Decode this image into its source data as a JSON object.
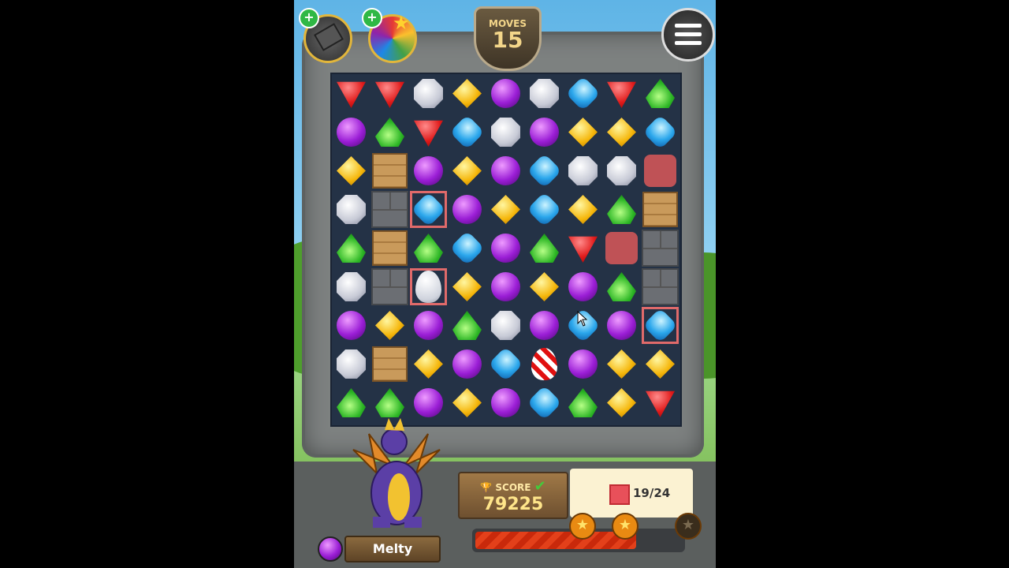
{
  "hud": {
    "moves_label": "MOVES",
    "moves_value": "15",
    "score_label": "SCORE",
    "score_value": "79225",
    "goal_text": "19/24",
    "progress_fraction": 0.78,
    "stars_earned": 2,
    "stars_total": 3,
    "character_name": "Melty"
  },
  "board": {
    "rows": [
      [
        "red",
        "red",
        "white",
        "yellow",
        "purple",
        "white",
        "blue",
        "red",
        "green"
      ],
      [
        "purple",
        "green",
        "red",
        "blue",
        "white",
        "purple",
        "yellow",
        "yellow",
        "blue"
      ],
      [
        "yellow",
        "crate",
        "purple",
        "yellow",
        "purple",
        "blue",
        "white",
        "white",
        "jelly"
      ],
      [
        "white",
        "stone",
        "blue",
        "purple",
        "yellow",
        "blue",
        "yellow",
        "green",
        "crate"
      ],
      [
        "green",
        "crate",
        "green",
        "blue",
        "purple",
        "green",
        "red",
        "jelly",
        "stone"
      ],
      [
        "white",
        "stone",
        "egg-white",
        "yellow",
        "purple",
        "yellow",
        "purple",
        "green",
        "stone"
      ],
      [
        "purple",
        "yellow",
        "purple",
        "green",
        "white",
        "purple",
        "blue",
        "purple",
        "blue"
      ],
      [
        "white",
        "crate",
        "yellow",
        "purple",
        "blue",
        "egg-red",
        "purple",
        "yellow",
        "yellow"
      ],
      [
        "green",
        "green",
        "purple",
        "yellow",
        "purple",
        "blue",
        "green",
        "yellow",
        "red"
      ]
    ],
    "chained": [
      "3-2",
      "5-2",
      "6-8"
    ]
  },
  "colors": {
    "accent": "#e3401a",
    "moves_text": "#f3d68a"
  },
  "icons": [
    "plus-icon",
    "hammer-booster-icon",
    "color-orb-booster-icon",
    "menu-icon",
    "trophy-icon",
    "checkmark-icon",
    "star-icon",
    "dragon-avatar",
    "purple-gem-icon"
  ]
}
